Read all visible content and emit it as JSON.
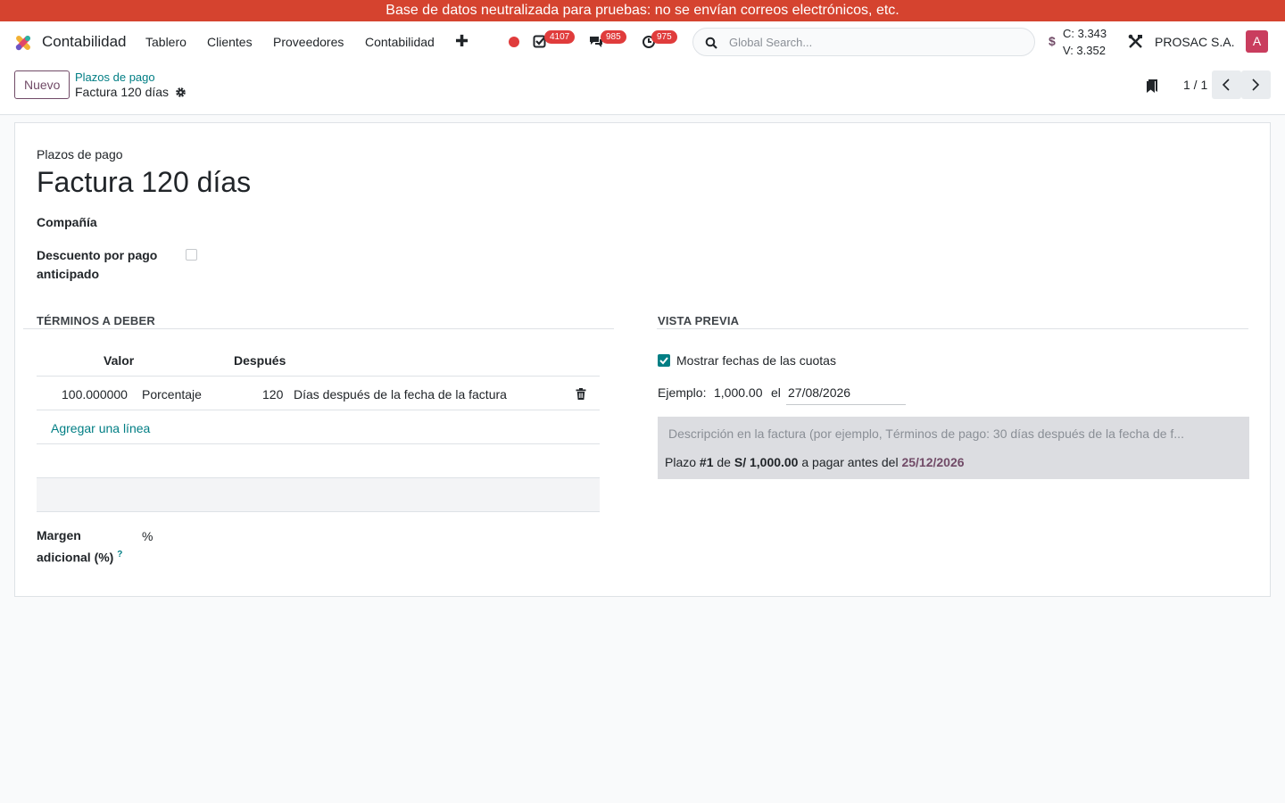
{
  "banner": {
    "text": "Base de datos neutralizada para pruebas: no se envían correos electrónicos, etc."
  },
  "navbar": {
    "app_name": "Contabilidad",
    "menu": [
      "Tablero",
      "Clientes",
      "Proveedores",
      "Contabilidad"
    ],
    "plus": "✚",
    "badges": {
      "activities": "4107",
      "messages": "985",
      "timers": "975"
    },
    "search_placeholder": "Global Search...",
    "currency_symbol": "$",
    "rate_buy": "C: 3.343",
    "rate_sell": "V: 3.352",
    "company": "PROSAC S.A.",
    "avatar_letter": "A"
  },
  "control_panel": {
    "new_button": "Nuevo",
    "breadcrumb_parent": "Plazos de pago",
    "breadcrumb_current": "Factura 120 días",
    "pager": "1 / 1"
  },
  "form": {
    "model_label": "Plazos de pago",
    "title": "Factura 120 días",
    "company_label": "Compañía",
    "early_discount_label_1": "Descuento por pago",
    "early_discount_label_2": "anticipado",
    "terms_section": "TÉRMINOS A DEBER",
    "preview_section": "VISTA PREVIA",
    "table": {
      "headers": [
        "Valor",
        "Después"
      ],
      "rows": [
        {
          "value": "100.000000",
          "type": "Porcentaje",
          "days": "120",
          "delay": "Días después de la fecha de la factura"
        }
      ],
      "add_line": "Agregar una línea"
    },
    "margin_label_1": "Margen",
    "margin_label_2": "adicional (%)",
    "margin_help": "?",
    "margin_unit": "%",
    "preview": {
      "show_dates_label": "Mostrar fechas de las cuotas",
      "example_label": "Ejemplo:",
      "example_amount": "1,000.00",
      "example_on": "el",
      "example_date": "27/08/2026",
      "description_placeholder": "Descripción en la factura (por ejemplo, Términos de pago: 30 días después de la fecha de f...",
      "line_prefix": "Plazo",
      "line_num": "#1",
      "line_de": "de",
      "line_amount": "S/ 1,000.00",
      "line_pay": "a pagar antes del",
      "line_date": "25/12/2026"
    }
  }
}
